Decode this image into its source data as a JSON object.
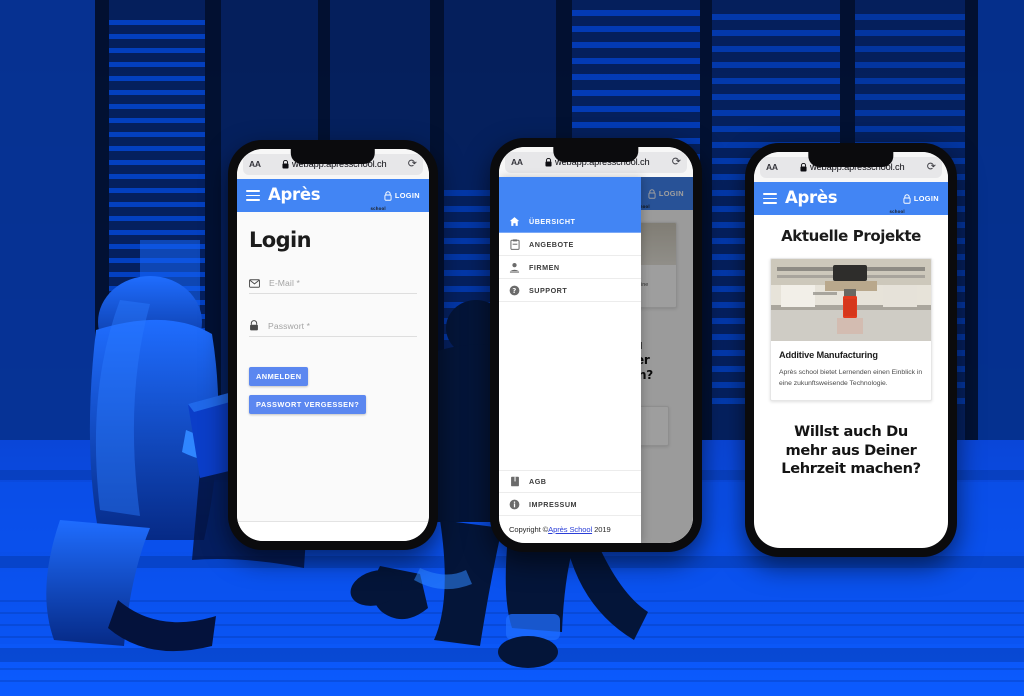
{
  "background": {
    "description": "duotone-blue-photo-students-on-steps",
    "tint_primary": "#0a53ff",
    "tint_shadow": "#04113f",
    "tint_highlight": "#2f7bff"
  },
  "browser": {
    "text_size_label": "AA",
    "lock_icon": "lock-icon",
    "url": "webapp.apresschool.ch",
    "reload_icon": "reload-icon"
  },
  "appbar": {
    "menu_icon": "hamburger-icon",
    "brand": "Après",
    "brand_sub": "school",
    "login_icon": "lock-icon",
    "login_label": "LOGIN",
    "accent": "#4285f4"
  },
  "phone1": {
    "title": "Login",
    "email_field": {
      "icon": "envelope-icon",
      "label": "E-Mail *",
      "value": ""
    },
    "password_field": {
      "icon": "lock-icon",
      "label": "Passwort *",
      "value": ""
    },
    "submit_label": "ANMELDEN",
    "forgot_label": "PASSWORT VERGESSEN?"
  },
  "phone2": {
    "menu_items": [
      {
        "icon": "home-icon",
        "label": "ÜBERSICHT",
        "active": true
      },
      {
        "icon": "clipboard-icon",
        "label": "ANGEBOTE",
        "active": false
      },
      {
        "icon": "person-icon",
        "label": "FIRMEN",
        "active": false
      },
      {
        "icon": "help-circle-icon",
        "label": "SUPPORT",
        "active": false
      }
    ],
    "footer_items": [
      {
        "icon": "book-icon",
        "label": "AGB"
      },
      {
        "icon": "info-circle-icon",
        "label": "IMPRESSUM"
      }
    ],
    "copyright_prefix": "Copyright ©",
    "copyright_link": "Après School",
    "copyright_suffix": " 2019"
  },
  "phone3": {
    "heading": "Aktuelle Projekte",
    "card": {
      "image": "3d-printer-photo",
      "title": "Additive Manufacturing",
      "text": "Après school bietet Lernenden einen Einblick in eine zukunftsweisende Technologie."
    },
    "cta_line1": "Willst auch Du",
    "cta_line2": "mehr aus Deiner",
    "cta_line3": "Lehrzeit machen?"
  }
}
